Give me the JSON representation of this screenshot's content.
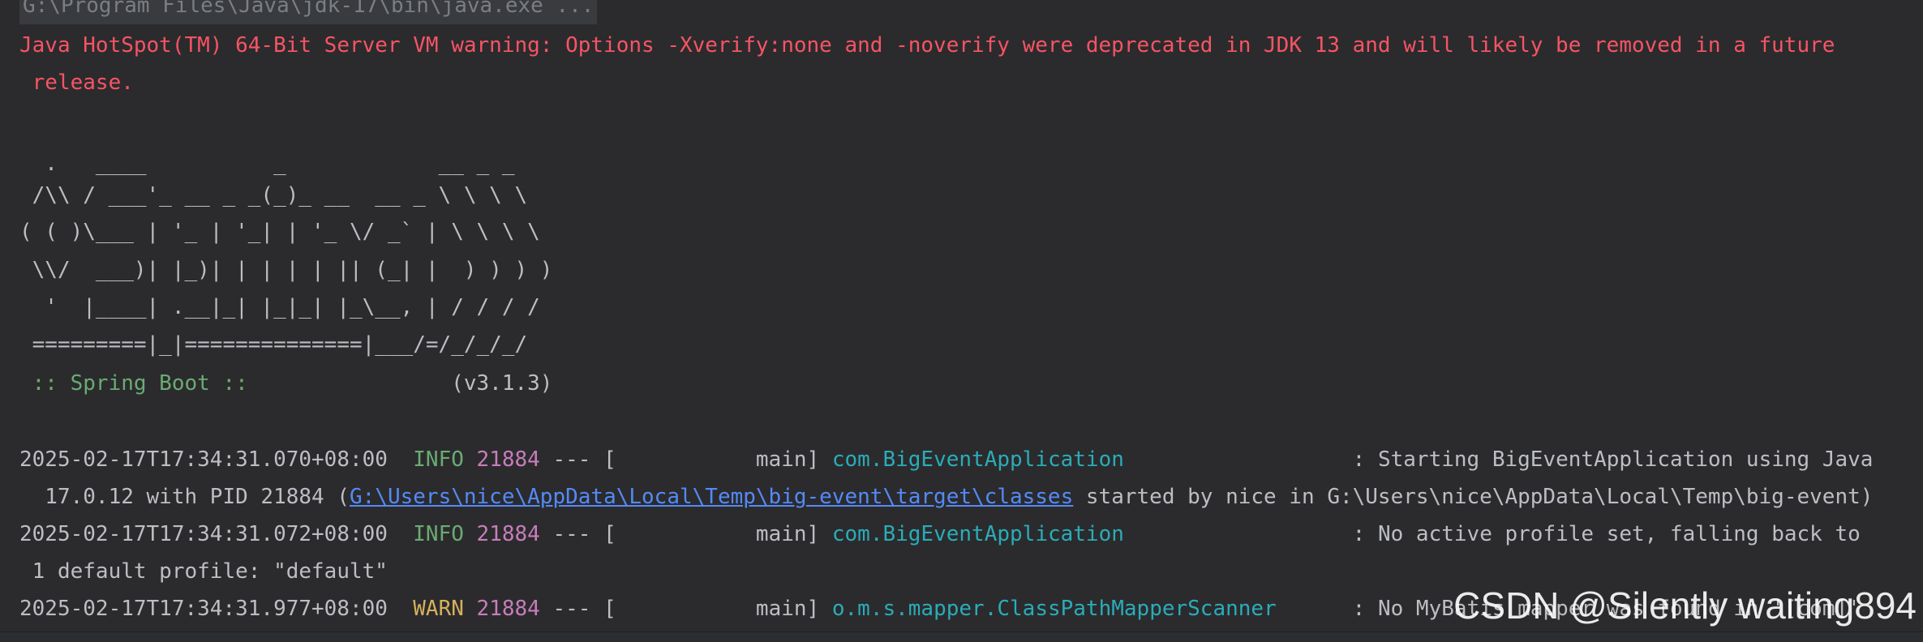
{
  "console": {
    "command": "G:\\Program Files\\Java\\jdk-17\\bin\\java.exe ...",
    "jvm_warning_1": "Java HotSpot(TM) 64-Bit Server VM warning: Options -Xverify:none and -noverify were deprecated in JDK 13 and will likely be removed in a future",
    "jvm_warning_2": " release.",
    "banner": [
      "  .   ____          _            __ _ _",
      " /\\\\ / ___'_ __ _ _(_)_ __  __ _ \\ \\ \\ \\",
      "( ( )\\___ | '_ | '_| | '_ \\/ _` | \\ \\ \\ \\",
      " \\\\/  ___)| |_)| | | | | || (_| |  ) ) ) )",
      "  '  |____| .__|_| |_|_| |_\\__, | / / / /",
      " =========|_|==============|___/=/_/_/_/"
    ],
    "spring_label": " :: Spring Boot :: ",
    "spring_version": "               (v3.1.3)",
    "logs": [
      {
        "timestamp": "2025-02-17T17:34:31.070+08:00",
        "level": "INFO",
        "pid": "21884",
        "sep": " --- [",
        "thread": "           main] ",
        "logger": "com.BigEventApplication",
        "pad": "                  ",
        "message": ": Starting BigEventApplication using Java",
        "cont_prefix": "  17.0.12 with PID 21884 (",
        "cont_link": "G:\\Users\\nice\\AppData\\Local\\Temp\\big-event\\target\\classes",
        "cont_suffix": " started by nice in G:\\Users\\nice\\AppData\\Local\\Temp\\big-event)"
      },
      {
        "timestamp": "2025-02-17T17:34:31.072+08:00",
        "level": "INFO",
        "pid": "21884",
        "sep": " --- [",
        "thread": "           main] ",
        "logger": "com.BigEventApplication",
        "pad": "                  ",
        "message": ": No active profile set, falling back to",
        "cont_prefix": " 1 default profile: \"default\""
      },
      {
        "timestamp": "2025-02-17T17:34:31.977+08:00",
        "level": "WARN",
        "pid": "21884",
        "sep": " --- [",
        "thread": "           main] ",
        "logger": "o.m.s.mapper.ClassPathMapperScanner",
        "pad": "      ",
        "message": ": No MyBatis mapper was found in '[com]'"
      }
    ]
  },
  "watermark": "CSDN @Silently waiting894"
}
